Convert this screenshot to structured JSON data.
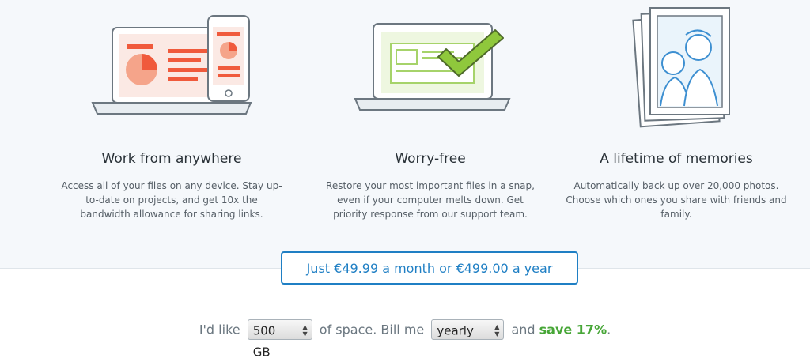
{
  "features": [
    {
      "title": "Work from anywhere",
      "description": "Access all of your files on any device. Stay up-to-date on projects, and get 10x the bandwidth allowance for sharing links."
    },
    {
      "title": "Worry-free",
      "description": "Restore your most important files in a snap, even if your computer melts down. Get priority response from our support team."
    },
    {
      "title": "A lifetime of memories",
      "description": "Automatically back up over 20,000 photos. Choose which ones you share with friends and family."
    }
  ],
  "pricing": {
    "banner": "Just €49.99 a month or €499.00 a year",
    "prefix": "I'd like",
    "space_value": "500 GB",
    "middle": "of space. Bill me",
    "billing_value": "yearly",
    "suffix": "and",
    "save_text": "save 17%",
    "period": "."
  },
  "colors": {
    "accent_blue": "#1f7fc4",
    "save_green": "#47a637",
    "illustration_red": "#f05a3c",
    "illustration_green": "#8fc83c"
  },
  "icons": [
    "laptop-phone-illustration",
    "laptop-checkmark-illustration",
    "photo-frames-illustration",
    "select-arrows-icon"
  ]
}
